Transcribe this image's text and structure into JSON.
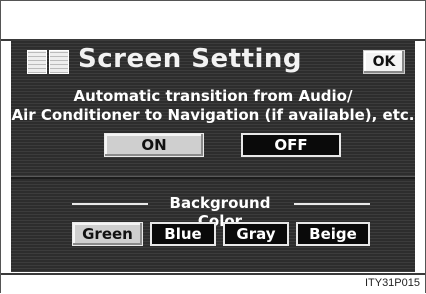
{
  "header": {
    "title": "Screen Setting",
    "ok_label": "OK"
  },
  "auto_transition": {
    "line1": "Automatic transition from Audio/",
    "line2": "Air Conditioner to Navigation (if available), etc.",
    "on_label": "ON",
    "off_label": "OFF",
    "selected": "ON"
  },
  "background_color": {
    "label": "Background Color",
    "options": [
      "Green",
      "Blue",
      "Gray",
      "Beige"
    ],
    "selected": "Green"
  },
  "figure_code": "ITY31P015"
}
